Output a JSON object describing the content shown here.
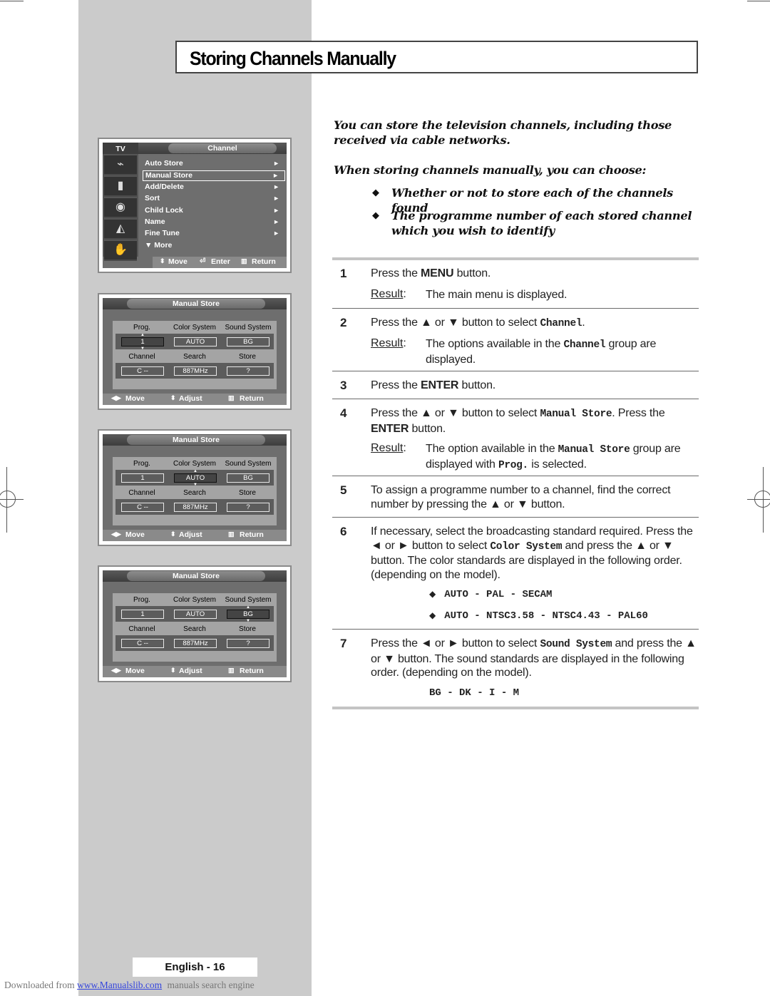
{
  "page": {
    "title": "Storing Channels Manually",
    "page_number": "English - 16",
    "footer": {
      "prefix": "Downloaded from",
      "link": "www.Manualslib.com",
      "suffix": "manuals search engine"
    }
  },
  "osd_main_menu": {
    "tab": "TV",
    "header": "Channel",
    "icons": [
      "antenna-icon",
      "picture-icon",
      "sound-icon",
      "channel-icon",
      "setup-icon"
    ],
    "items": [
      {
        "label": "Auto Store",
        "arrow": "►",
        "selected": false
      },
      {
        "label": "Manual Store",
        "arrow": "►",
        "selected": true
      },
      {
        "label": "Add/Delete",
        "arrow": "►",
        "selected": false
      },
      {
        "label": "Sort",
        "arrow": "►",
        "selected": false
      },
      {
        "label": "Child Lock",
        "arrow": "►",
        "selected": false
      },
      {
        "label": "Name",
        "arrow": "►",
        "selected": false
      },
      {
        "label": "Fine Tune",
        "arrow": "►",
        "selected": false
      },
      {
        "label": "▼  More",
        "arrow": "",
        "selected": false
      }
    ],
    "footer": {
      "move": "Move",
      "enter": "Enter",
      "return": "Return"
    }
  },
  "osd_manual_store": {
    "header": "Manual Store",
    "labels": {
      "prog": "Prog.",
      "color_system": "Color System",
      "sound_system": "Sound System",
      "channel": "Channel",
      "search": "Search",
      "store": "Store"
    },
    "values": {
      "prog": "1",
      "color_system": "AUTO",
      "sound_system": "BG",
      "channel": "C --",
      "search": "887MHz",
      "store": "?"
    },
    "footer": {
      "move": "Move",
      "adjust": "Adjust",
      "return": "Return"
    },
    "screens": [
      {
        "selected": "prog"
      },
      {
        "selected": "color_system"
      },
      {
        "selected": "sound_system"
      }
    ]
  },
  "intro": {
    "p1": "You can store the television channels, including those received via cable networks.",
    "p2": "When storing channels manually, you can choose:",
    "bullets": [
      "Whether or not to store each of the channels found",
      "The programme number of each stored channel which you wish to identify"
    ]
  },
  "steps": [
    {
      "num": "1",
      "text": [
        "Press the ",
        {
          "b": "MENU"
        },
        " button."
      ],
      "result_label": "Result",
      "result": [
        "The main menu is displayed."
      ]
    },
    {
      "num": "2",
      "text": [
        "Press the ▲ or ▼ button to select ",
        {
          "m": "Channel"
        },
        "."
      ],
      "result_label": "Result",
      "result": [
        "The options available in the ",
        {
          "m": "Channel"
        },
        " group are displayed."
      ]
    },
    {
      "num": "3",
      "text": [
        "Press the ",
        {
          "b": "ENTER"
        },
        " button."
      ]
    },
    {
      "num": "4",
      "text": [
        "Press the ▲ or ▼ button to select ",
        {
          "m": "Manual Store"
        },
        ". Press the ",
        {
          "b": "ENTER"
        },
        " button."
      ],
      "result_label": "Result",
      "result": [
        "The option available in the ",
        {
          "m": "Manual Store"
        },
        " group are displayed with ",
        {
          "m": "Prog."
        },
        " is selected."
      ]
    },
    {
      "num": "5",
      "text": [
        "To assign a programme number to a channel, find the correct number by pressing the ▲ or ▼ button."
      ]
    },
    {
      "num": "6",
      "text": [
        "If necessary, select the broadcasting standard required. Press the ◄ or ► button to select ",
        {
          "m": "Color System"
        },
        " and press the ▲ or ▼ button. The color standards are displayed in the following order. (depending on the model)."
      ],
      "sequences": [
        "AUTO - PAL - SECAM",
        "AUTO - NTSC3.58 - NTSC4.43 - PAL60"
      ]
    },
    {
      "num": "7",
      "text": [
        "Press the ◄ or ► button to select ",
        {
          "m": "Sound System"
        },
        " and press the ▲ or ▼ button. The sound standards are displayed in the following order. (depending on the model)."
      ],
      "sequences": [
        "BG - DK - I - M"
      ]
    }
  ],
  "colors": {
    "sidebar": "#cbcbcb",
    "osd_bg": "#6e6e6e",
    "link": "#3344dd"
  }
}
